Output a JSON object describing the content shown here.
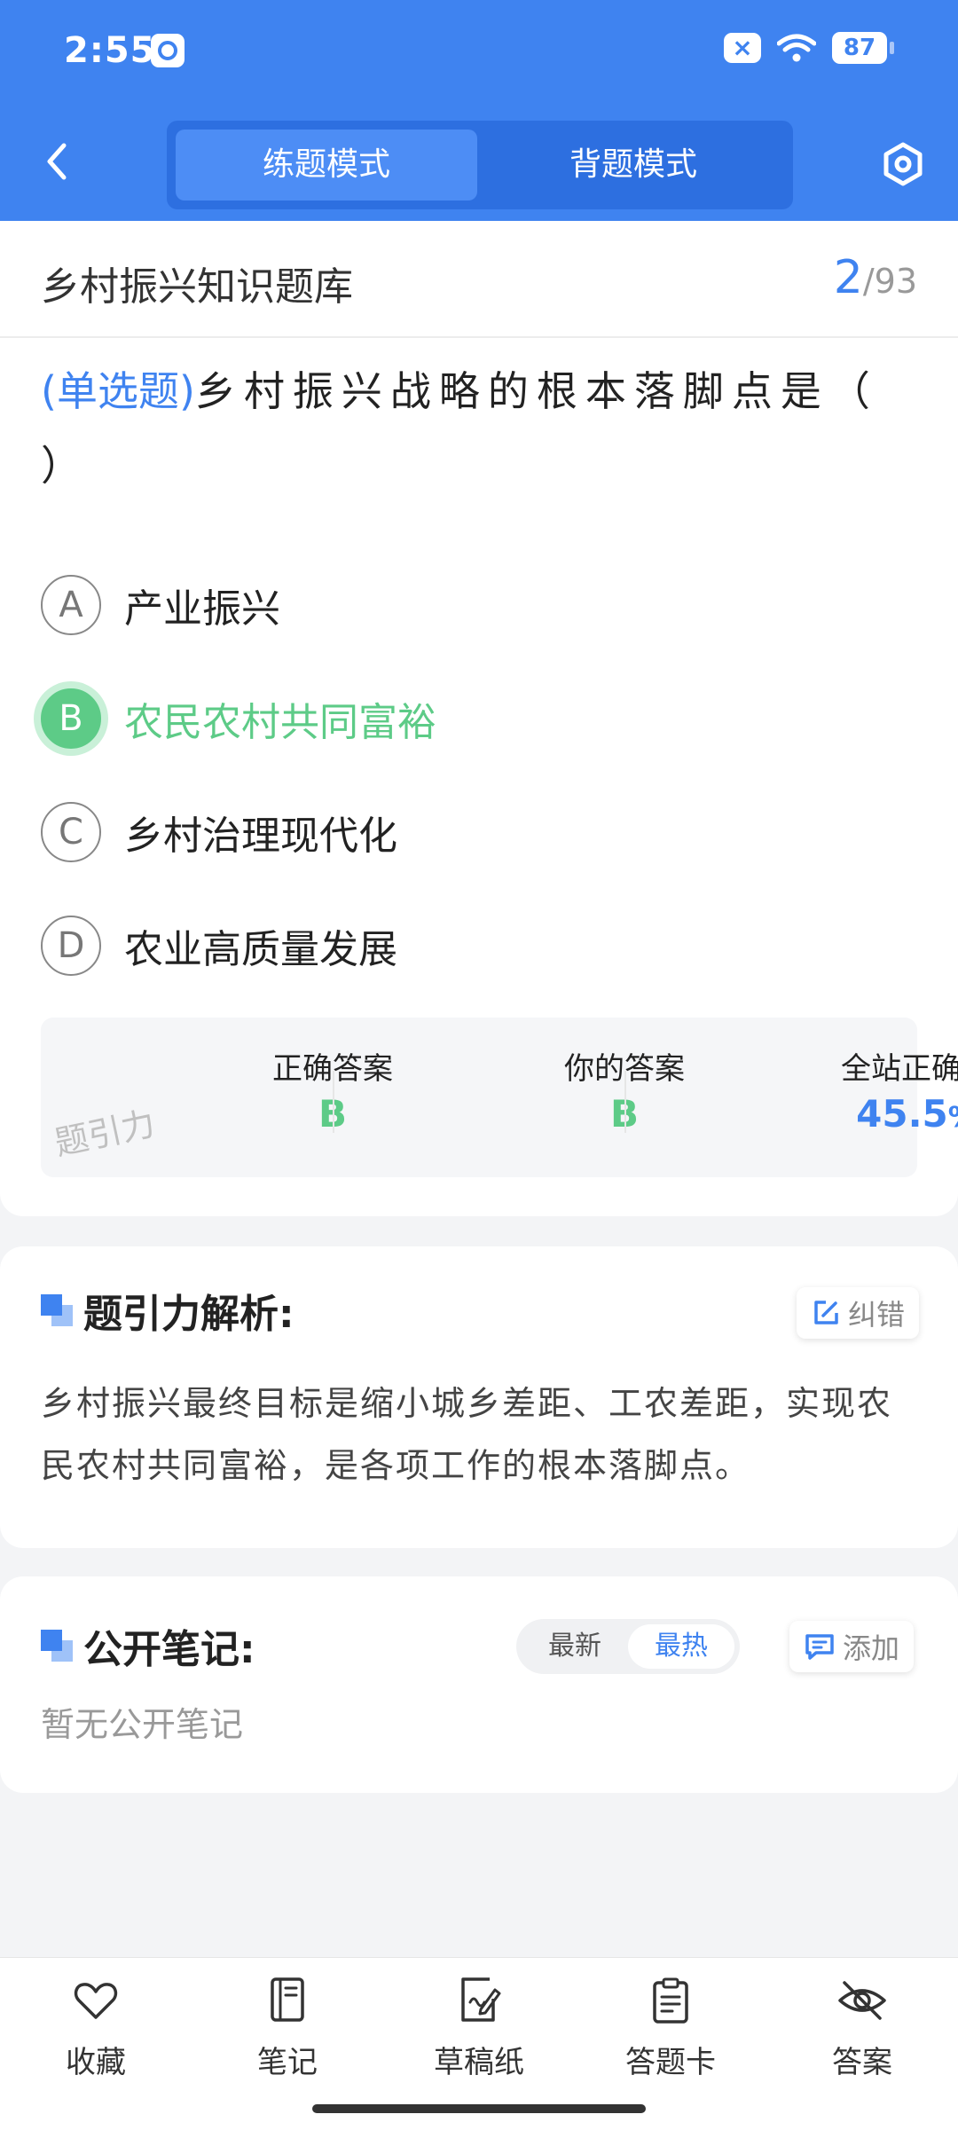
{
  "status_bar": {
    "time": "2:55",
    "battery": "87",
    "sim_icon": "sim-x-icon",
    "wifi_icon": "wifi-icon"
  },
  "header": {
    "back_icon": "chevron-left-icon",
    "modes": [
      "练题模式",
      "背题模式"
    ],
    "active_mode": "练题模式",
    "settings_icon": "hexagon-settings-icon"
  },
  "question_bank": {
    "title": "乡村振兴知识题库",
    "current": "2",
    "separator": "/",
    "total": "93"
  },
  "question": {
    "type": "(单选题)",
    "text": "乡村振兴战略的根本落脚点是（ ）",
    "options": [
      {
        "letter": "A",
        "text": "产业振兴"
      },
      {
        "letter": "B",
        "text": "农民农村共同富裕"
      },
      {
        "letter": "C",
        "text": "乡村治理现代化"
      },
      {
        "letter": "D",
        "text": "农业高质量发展"
      }
    ],
    "correct_option": "B"
  },
  "stats": {
    "correct_label": "正确答案",
    "correct_value": "B",
    "yours_label": "你的答案",
    "yours_value": "B",
    "rate_label": "全站正确率",
    "rate_value": "45.5",
    "rate_unit": "%",
    "watermark": "题引力"
  },
  "analysis": {
    "title": "题引力解析:",
    "report_label": "纠错",
    "text": "乡村振兴最终目标是缩小城乡差距、工农差距，实现农民农村共同富裕，是各项工作的根本落脚点。"
  },
  "notes": {
    "title": "公开笔记:",
    "sort_new": "最新",
    "sort_hot": "最热",
    "add_label": "添加",
    "empty": "暂无公开笔记"
  },
  "bottom_tabs": [
    {
      "label": "收藏",
      "icon": "heart-icon"
    },
    {
      "label": "笔记",
      "icon": "notebook-icon"
    },
    {
      "label": "草稿纸",
      "icon": "draft-paper-icon"
    },
    {
      "label": "答题卡",
      "icon": "answer-card-icon"
    },
    {
      "label": "答案",
      "icon": "eye-off-icon"
    }
  ],
  "colors": {
    "primary": "#3f83f0",
    "correct": "#5dcb87"
  }
}
